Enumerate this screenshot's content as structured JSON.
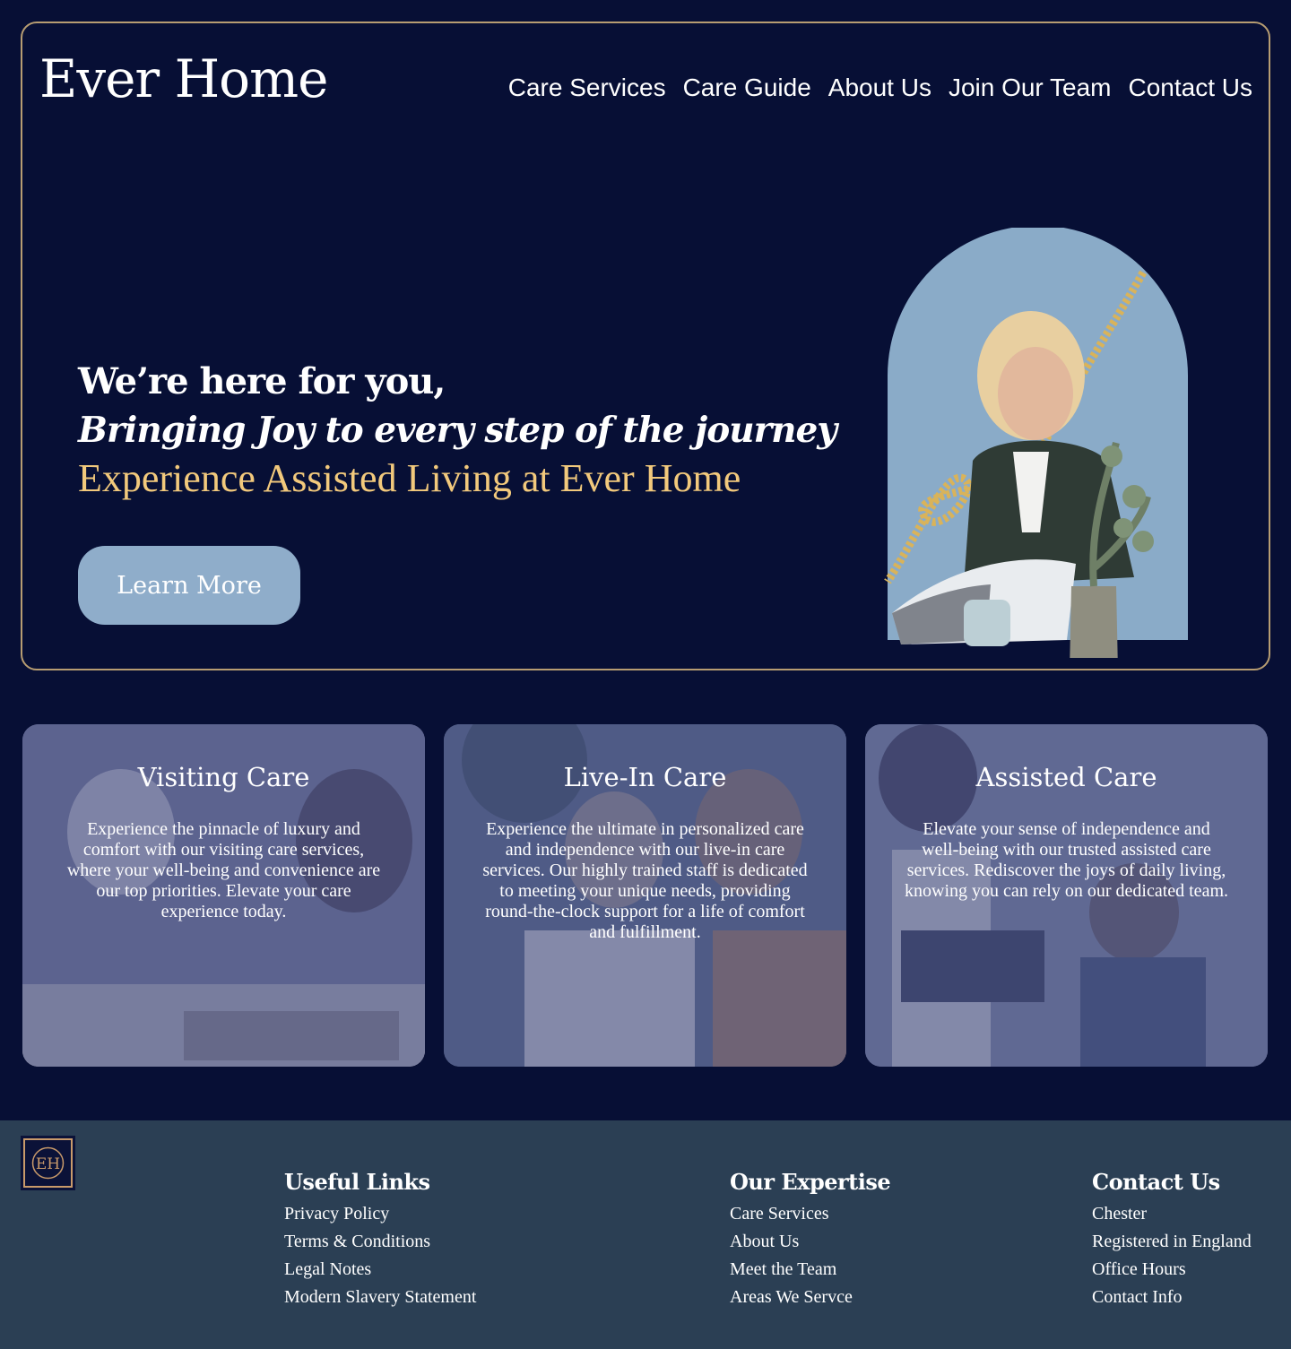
{
  "brand": {
    "name": "Ever Home",
    "monogram": "EH"
  },
  "nav": {
    "items": [
      "Care Services",
      "Care Guide",
      "About Us",
      "Join Our Team",
      "Contact Us"
    ]
  },
  "hero": {
    "line1": "We’re here for you,",
    "line2": "Bringing Joy to every step of the journey",
    "line3": "Experience Assisted Living at Ever Home",
    "cta_label": "Learn More",
    "image_icon": "woman-reading-newspaper-photo"
  },
  "cards": [
    {
      "title": "Visiting Care",
      "text": "Experience the pinnacle of luxury and comfort with our visiting care services, where your well-being and convenience are our top priorities. Elevate your care experience today."
    },
    {
      "title": "Live-In Care",
      "text": "Experience the ultimate in personalized care and independence with our live-in care services. Our highly trained staff is dedicated to meeting your unique needs, providing round-the-clock support for a life of comfort and fulfillment."
    },
    {
      "title": "Assisted Care",
      "text": "Elevate your sense of independence and well-being with our trusted assisted care services. Rediscover the joys of daily living, knowing you can rely on our dedicated team."
    }
  ],
  "footer": {
    "useful_links": {
      "title": "Useful Links",
      "items": [
        "Privacy Policy",
        "Terms & Conditions",
        "Legal Notes",
        "Modern Slavery Statement"
      ]
    },
    "expertise": {
      "title": "Our Expertise",
      "items": [
        "Care Services",
        "About Us",
        "Meet the Team",
        "Areas We Servce"
      ]
    },
    "contact": {
      "title": "Contact Us",
      "items": [
        "Chester",
        "Registered in England",
        "Office Hours",
        "Contact Info"
      ]
    }
  },
  "colors": {
    "background": "#070f35",
    "gold": "#f2c97c",
    "border": "#b79d72",
    "button": "#8fadca",
    "footer": "#2b3f54"
  }
}
